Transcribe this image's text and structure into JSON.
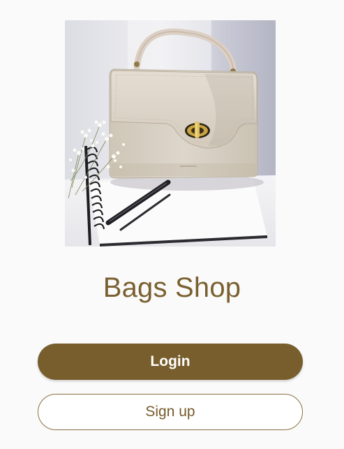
{
  "app": {
    "title": "Bags Shop"
  },
  "buttons": {
    "login_label": "Login",
    "signup_label": "Sign up"
  },
  "colors": {
    "background": "#fafafa",
    "brand": "#785e2d",
    "title_text": "#7a6030",
    "button_text_light": "#ffffff"
  }
}
